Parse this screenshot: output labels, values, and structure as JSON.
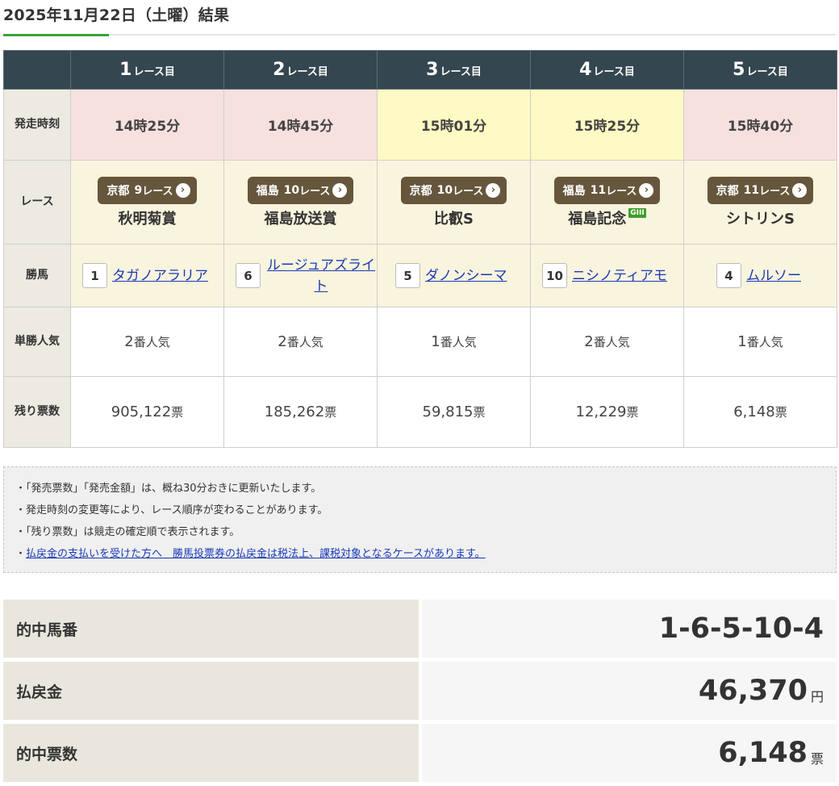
{
  "page_title": "2025年11月22日（土曜）結果",
  "races": [
    {
      "number": "1",
      "suffix": "レース目",
      "start_time": "14時25分",
      "time_bg": "pink",
      "venue": "京都",
      "race_no": "9",
      "race_suffix": "レース",
      "race_name": "秋明菊賞",
      "grade": "",
      "horse_number": "1",
      "horse_name": "タガノアラリア",
      "popularity_num": "2",
      "popularity_label": "番人気",
      "votes_left": "905,122",
      "votes_unit": "票"
    },
    {
      "number": "2",
      "suffix": "レース目",
      "start_time": "14時45分",
      "time_bg": "pink",
      "venue": "福島",
      "race_no": "10",
      "race_suffix": "レース",
      "race_name": "福島放送賞",
      "grade": "",
      "horse_number": "6",
      "horse_name": "ルージュアズライト",
      "popularity_num": "2",
      "popularity_label": "番人気",
      "votes_left": "185,262",
      "votes_unit": "票"
    },
    {
      "number": "3",
      "suffix": "レース目",
      "start_time": "15時01分",
      "time_bg": "yellow",
      "venue": "京都",
      "race_no": "10",
      "race_suffix": "レース",
      "race_name": "比叡S",
      "grade": "",
      "horse_number": "5",
      "horse_name": "ダノンシーマ",
      "popularity_num": "1",
      "popularity_label": "番人気",
      "votes_left": "59,815",
      "votes_unit": "票"
    },
    {
      "number": "4",
      "suffix": "レース目",
      "start_time": "15時25分",
      "time_bg": "yellow",
      "venue": "福島",
      "race_no": "11",
      "race_suffix": "レース",
      "race_name": "福島記念",
      "grade": "GIII",
      "horse_number": "10",
      "horse_name": "ニシノティアモ",
      "popularity_num": "2",
      "popularity_label": "番人気",
      "votes_left": "12,229",
      "votes_unit": "票"
    },
    {
      "number": "5",
      "suffix": "レース目",
      "start_time": "15時40分",
      "time_bg": "pink",
      "venue": "京都",
      "race_no": "11",
      "race_suffix": "レース",
      "race_name": "シトリンS",
      "grade": "",
      "horse_number": "4",
      "horse_name": "ムルソー",
      "popularity_num": "1",
      "popularity_label": "番人気",
      "votes_left": "6,148",
      "votes_unit": "票"
    }
  ],
  "row_headers": {
    "start_time": "発走時刻",
    "race": "レース",
    "winner": "勝馬",
    "popularity": "単勝人気",
    "votes_left": "残り票数"
  },
  "notes": [
    "・「発売票数」「発売金額」は、概ね30分おきに更新いたします。",
    "・発走時刻の変更等により、レース順序が変わることがあります。",
    "・「残り票数」は競走の確定順で表示されます。"
  ],
  "note_link_prefix": "・",
  "note_link": "払戻金の支払いを受けた方へ　勝馬投票券の払戻金は税法上、課税対象となるケースがあります。",
  "summary": {
    "hit_numbers_label": "的中馬番",
    "hit_numbers_value": "1-6-5-10-4",
    "payout_label": "払戻金",
    "payout_value": "46,370",
    "payout_unit": "円",
    "hit_votes_label": "的中票数",
    "hit_votes_value": "6,148",
    "hit_votes_unit": "票"
  },
  "colors": {
    "header_bg": "#34464f",
    "accent_green": "#3ca03c",
    "time_pink": "#f6e1df",
    "time_yellow": "#fff9c3",
    "cream": "#f9f4dd",
    "badge_brown": "#66563c",
    "link_blue": "#1a3ab7"
  },
  "icons": {
    "race_link": "chevron-right-circle-icon"
  }
}
